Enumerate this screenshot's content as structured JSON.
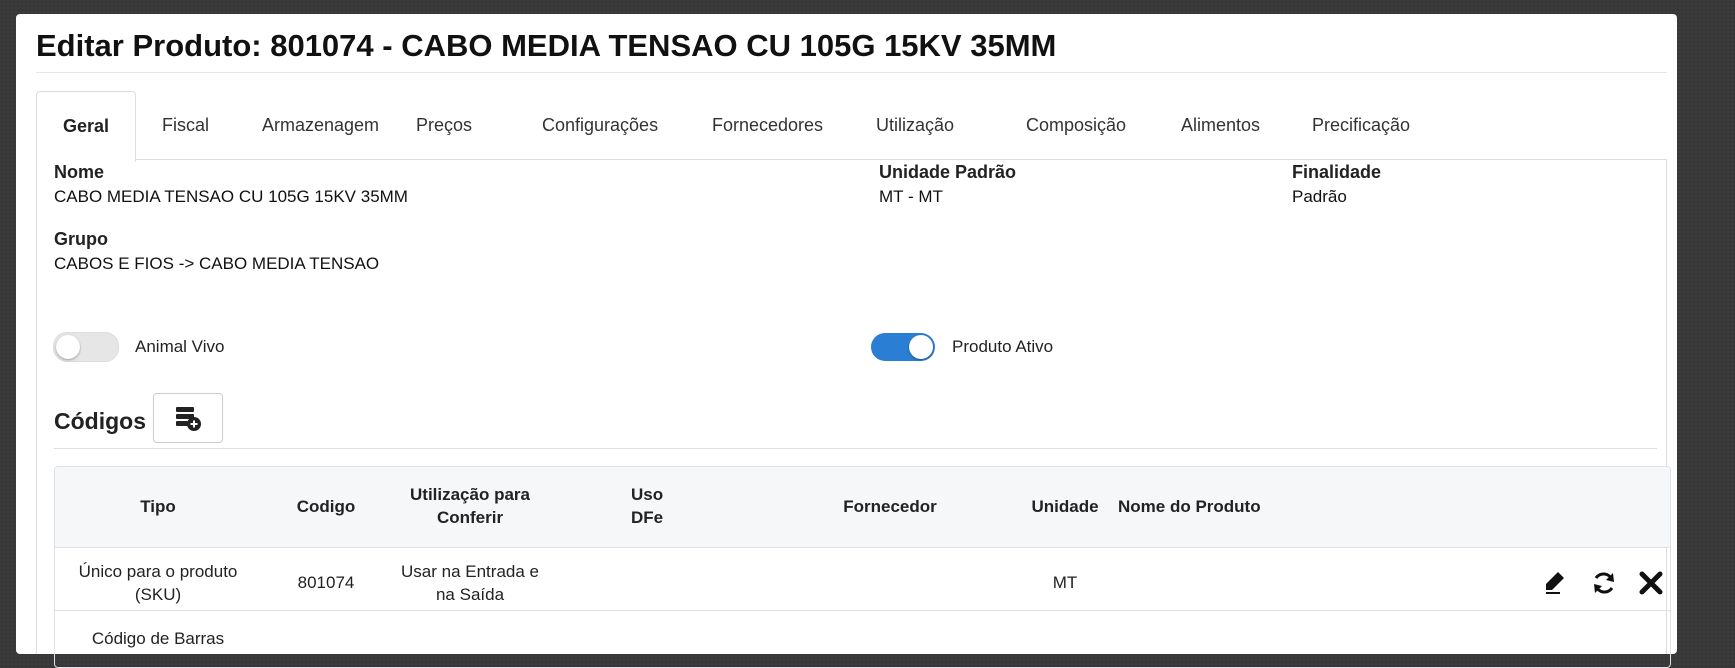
{
  "page": {
    "title": "Editar Produto: 801074 - CABO MEDIA TENSAO CU 105G 15KV 35MM"
  },
  "tabs": [
    {
      "label": "Geral",
      "active": true
    },
    {
      "label": "Fiscal"
    },
    {
      "label": "Armazenagem"
    },
    {
      "label": "Preços"
    },
    {
      "label": "Configurações"
    },
    {
      "label": "Fornecedores"
    },
    {
      "label": "Utilização"
    },
    {
      "label": "Composição"
    },
    {
      "label": "Alimentos"
    },
    {
      "label": "Precificação"
    }
  ],
  "general": {
    "nome_label": "Nome",
    "nome_value": "CABO MEDIA TENSAO CU 105G 15KV 35MM",
    "unidade_label": "Unidade Padrão",
    "unidade_value": "MT - MT",
    "finalidade_label": "Finalidade",
    "finalidade_value": "Padrão",
    "grupo_label": "Grupo",
    "grupo_value": "CABOS E FIOS -> CABO MEDIA TENSAO"
  },
  "toggles": {
    "animal_vivo": {
      "label": "Animal Vivo",
      "on": false
    },
    "produto_ativo": {
      "label": "Produto Ativo",
      "on": true
    }
  },
  "codes": {
    "title": "Códigos",
    "add_icon": "add-code-icon",
    "headers": {
      "tipo": "Tipo",
      "codigo": "Codigo",
      "utilizacao_line1": "Utilização para",
      "utilizacao_line2": "Conferir",
      "uso_line1": "Uso",
      "uso_line2": "DFe",
      "fornecedor": "Fornecedor",
      "unidade": "Unidade",
      "nome_produto": "Nome do Produto"
    },
    "rows": [
      {
        "tipo_line1": "Único para o produto",
        "tipo_line2": "(SKU)",
        "codigo": "801074",
        "utilizacao_line1": "Usar na Entrada e",
        "utilizacao_line2": "na Saída",
        "uso_dfe": "",
        "fornecedor": "",
        "unidade": "MT",
        "nome_produto": ""
      }
    ],
    "next_row_partial": "Código de Barras"
  },
  "colors": {
    "toggle_on": "#2a7fd4",
    "background": "#3a3a3a"
  }
}
